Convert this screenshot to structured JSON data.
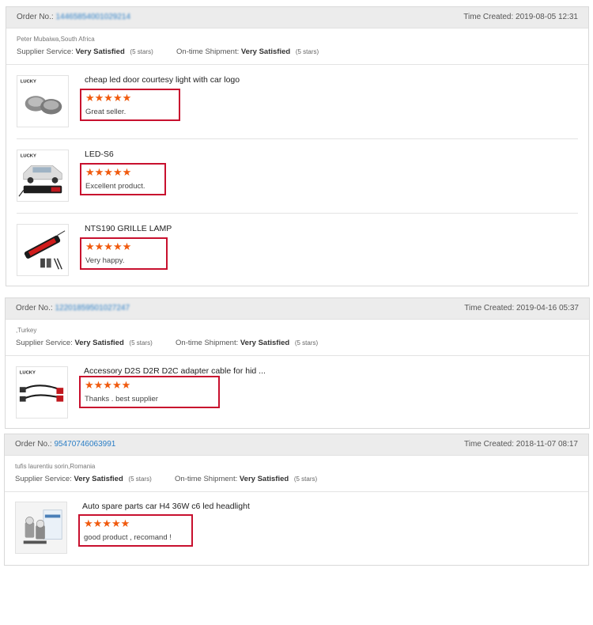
{
  "orders": [
    {
      "order_label": "Order No.:",
      "order_no": "14465854001029214",
      "time_created": "Time Created: 2019-08-05 12:31",
      "buyer": "Peter Mubaiwa,South Africa",
      "supplier_service_label": "Supplier Service:",
      "supplier_service_value": "Very Satisfied",
      "supplier_service_stars": "(5 stars)",
      "shipment_label": "On-time Shipment:",
      "shipment_value": "Very Satisfied",
      "shipment_stars": "(5 stars)",
      "items": [
        {
          "title": "cheap led door courtesy light with car logo",
          "stars": "★★★★★",
          "rating": 5,
          "review": "Great seller.",
          "thumb_icon": "door-light-projector-icon"
        },
        {
          "title": "LED-S6",
          "stars": "★★★★★",
          "rating": 5,
          "review": "Excellent product.",
          "thumb_icon": "car-strobe-light-icon"
        },
        {
          "title": "NTS190 GRILLE LAMP",
          "stars": "★★★★★",
          "rating": 5,
          "review": "Very happy.",
          "thumb_icon": "grille-lamp-strip-icon"
        }
      ]
    },
    {
      "order_label": "Order No.:",
      "order_no": "12201859501027247",
      "time_created": "Time Created: 2019-04-16 05:37",
      "buyer": ",Turkey",
      "supplier_service_label": "Supplier Service:",
      "supplier_service_value": "Very Satisfied",
      "supplier_service_stars": "(5 stars)",
      "shipment_label": "On-time Shipment:",
      "shipment_value": "Very Satisfied",
      "shipment_stars": "(5 stars)",
      "items": [
        {
          "title": "Accessory D2S D2R D2C adapter cable for hid ...",
          "stars": "★★★★★",
          "rating": 5,
          "review": "Thanks . best supplier",
          "thumb_icon": "adapter-cable-icon"
        }
      ]
    },
    {
      "order_label": "Order No.:",
      "order_no": "95470746063991",
      "time_created": "Time Created: 2018-11-07 08:17",
      "buyer": "tufis laurentiu sorin,Romania",
      "supplier_service_label": "Supplier Service:",
      "supplier_service_value": "Very Satisfied",
      "supplier_service_stars": "(5 stars)",
      "shipment_label": "On-time Shipment:",
      "shipment_value": "Very Satisfied",
      "shipment_stars": "(5 stars)",
      "items": [
        {
          "title": "Auto spare parts car H4 36W c6 led headlight",
          "stars": "★★★★★",
          "rating": 5,
          "review": "good product , recomand !",
          "thumb_icon": "led-headlight-bulbs-icon"
        }
      ]
    }
  ],
  "brand_mark": "LUCKY",
  "colors": {
    "star": "#f05a0e",
    "highlight_border": "#c8102e",
    "order_link": "#2a7ec6",
    "header_bg": "#ececec"
  }
}
